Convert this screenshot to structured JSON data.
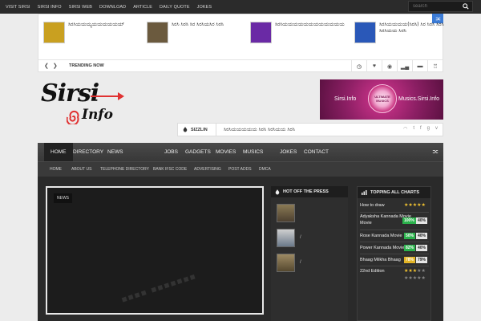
{
  "topnav": [
    "VISIT SIRSI",
    "SIRSI INFO",
    "SIRSI WEB",
    "DOWNLOAD",
    "ARTICLE",
    "DAILY QUOTE",
    "JOKES"
  ],
  "search": {
    "placeholder": "search"
  },
  "trending": {
    "label": "TRENDING NOW",
    "cards": [
      {
        "title": "ಸಿರಸಿಯಯಯ್ಯಯಯಯಯಯಯ್",
        "thumb_color": "#c9a020"
      },
      {
        "title": "ಸಿರಸಿ ಸಿರಸಿ ಸಿರ ಸಿರಸಿಯಸಿರ ಸಿರಸಿ",
        "thumb_color": "#6b5a3e"
      },
      {
        "title": "ಸಿರಸಿಯಯಯಯಯಯಯಯಯಯಯಯ",
        "thumb_color": "#6a2aa5"
      },
      {
        "title": "ಸಿರಸಿಯಯಯಯ(ಸಿರಸಿ) ಸಿರ ಸಿರಸಿ ಸಿರಸಿ ಸಿರಸಿಯಯ ಸಿರಸಿ",
        "thumb_color": "#2a58b8"
      }
    ]
  },
  "logo": {
    "line1": "Sirsi",
    "line2": "Info"
  },
  "banner": {
    "left_text": "Sirsi.Info",
    "right_text": "Musics.Sirsi.Info",
    "disc_text": "ULTIMATE MUSICS"
  },
  "sizzlin": {
    "label": "SIZZLIN",
    "text": "ಸಿರಸಿಯಯಯಯಯ ಸಿರಸಿ ಸಿರಸಿಯಯ ಸಿರಸಿ"
  },
  "mainnav": [
    "HOME",
    "DIRECTORY",
    "NEWS",
    "JOBS",
    "GADGETS",
    "MOVIES",
    "MUSICS",
    "JOKES",
    "CONTACT"
  ],
  "subnav": [
    "HOME",
    "ABOUT US",
    "TELEPHONE DIRECTORY",
    "BANK IFSC CODE",
    "ADVERTISING",
    "POST ADDS",
    "DMCA"
  ],
  "featured": {
    "badge": "NEWS"
  },
  "press": {
    "title": "HOT OFF THE PRESS",
    "items": [
      {
        "slash": ""
      },
      {
        "slash": "/"
      },
      {
        "slash": "/"
      }
    ]
  },
  "charts": {
    "title": "TOPPING ALL CHARTS",
    "rows": [
      {
        "name": "How to draw",
        "stars": 5
      },
      {
        "name": "Adyaksha Kannada Movie",
        "p1": "100%",
        "p2": "40%"
      },
      {
        "name": "Rose Kannada Movie",
        "p1": "50%",
        "p2": "40%"
      },
      {
        "name": "Power Kannada Movie",
        "p1": "82%",
        "p2": "40%"
      },
      {
        "name": "Bhaag Milkha Bhaag",
        "p1": "78%",
        "p2": "79%"
      },
      {
        "name": "22nd Edition",
        "stars": 3
      }
    ]
  },
  "colors": {
    "accent": "#3b7bd6",
    "brand_red": "#e03232",
    "banner": "#c42c85"
  }
}
